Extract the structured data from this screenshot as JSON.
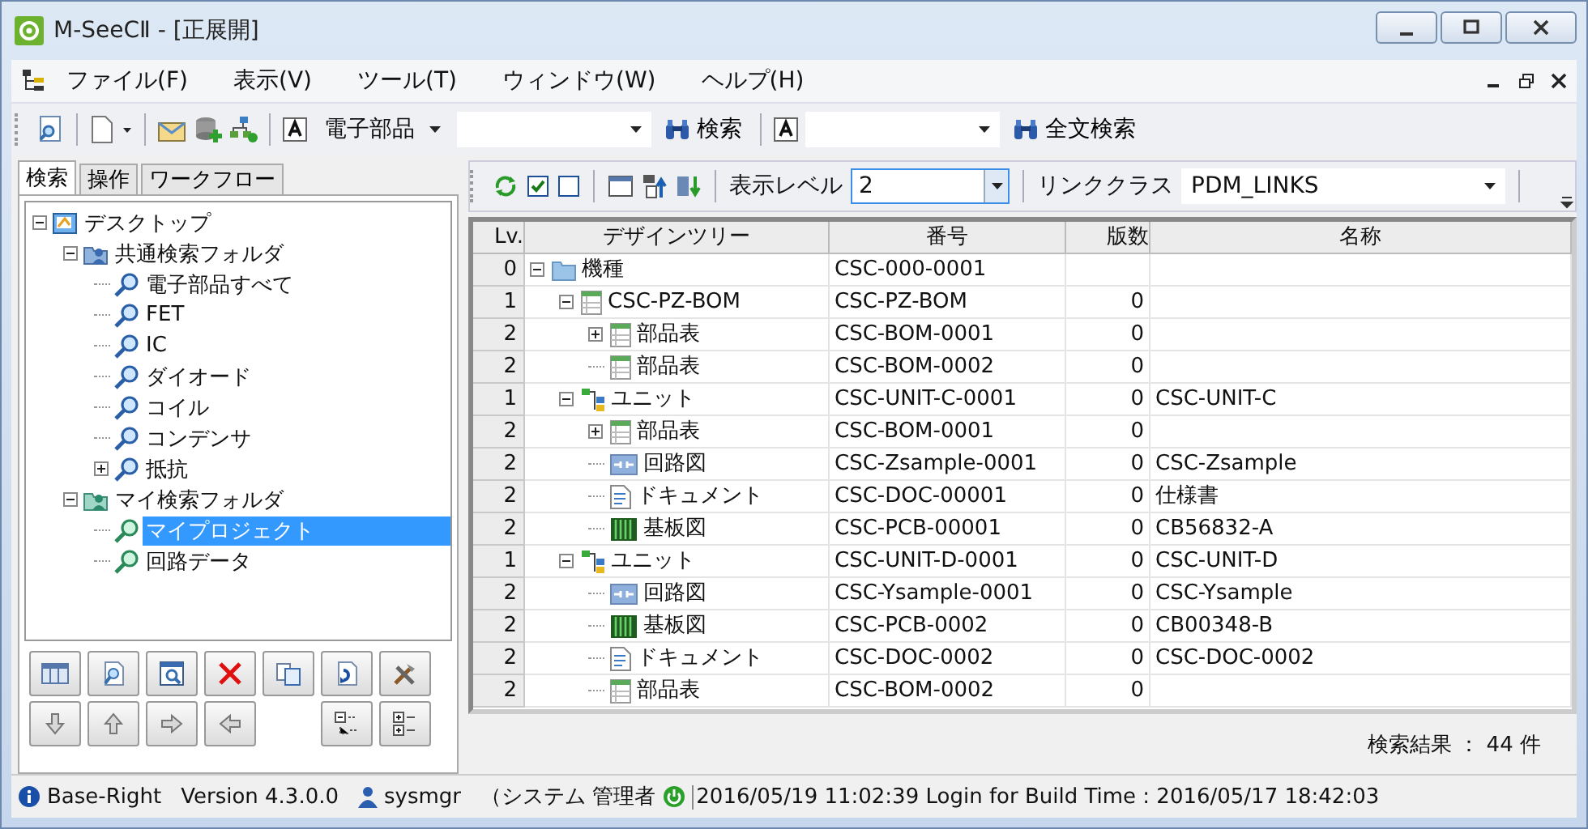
{
  "window": {
    "title": "M-SeeCⅡ - [正展開]"
  },
  "menu": [
    "ファイル(F)",
    "表示(V)",
    "ツール(T)",
    "ウィンドウ(W)",
    "ヘルプ(H)"
  ],
  "toolbar": {
    "category": "電子部品",
    "search_button": "検索",
    "fulltext_button": "全文検索"
  },
  "left_tabs": [
    {
      "label": "検索",
      "selected": true
    },
    {
      "label": "操作",
      "selected": false
    },
    {
      "label": "ワークフロー",
      "selected": false
    }
  ],
  "search_tree": [
    {
      "label": "デスクトップ",
      "kind": "desktop",
      "expanded": true,
      "selected": false,
      "children": [
        {
          "label": "共通検索フォルダ",
          "kind": "shared-folder",
          "expanded": true,
          "selected": false,
          "children": [
            {
              "label": "電子部品すべて",
              "kind": "search",
              "selected": false
            },
            {
              "label": "FET",
              "kind": "search",
              "selected": false
            },
            {
              "label": "IC",
              "kind": "search",
              "selected": false
            },
            {
              "label": "ダイオード",
              "kind": "search",
              "selected": false
            },
            {
              "label": "コイル",
              "kind": "search",
              "selected": false
            },
            {
              "label": "コンデンサ",
              "kind": "search",
              "selected": false
            },
            {
              "label": "抵抗",
              "kind": "search",
              "expanded": false,
              "selected": false
            }
          ]
        },
        {
          "label": "マイ検索フォルダ",
          "kind": "my-folder",
          "expanded": true,
          "selected": false,
          "children": [
            {
              "label": "マイプロジェクト",
              "kind": "my-search",
              "selected": true
            },
            {
              "label": "回路データ",
              "kind": "my-search",
              "selected": false
            }
          ]
        }
      ]
    }
  ],
  "design": {
    "level_label": "表示レベル",
    "level": "2",
    "link_label": "リンククラス",
    "link_class": "PDM_LINKS",
    "columns": [
      "Lv.",
      "デザインツリー",
      "番号",
      "版数",
      "名称"
    ],
    "rows": [
      {
        "lv": "0",
        "name": "機種",
        "kind": "folder",
        "number": "CSC-000-0001",
        "expanded": true,
        "children": [
          {
            "lv": "1",
            "name": "CSC-PZ-BOM",
            "kind": "bom",
            "number": "CSC-PZ-BOM",
            "version": "0",
            "expanded": true,
            "children": [
              {
                "lv": "2",
                "name": "部品表",
                "kind": "bom",
                "number": "CSC-BOM-0001",
                "version": "0",
                "expanded": false
              },
              {
                "lv": "2",
                "name": "部品表",
                "kind": "bom",
                "number": "CSC-BOM-0002",
                "version": "0"
              }
            ]
          },
          {
            "lv": "1",
            "name": "ユニット",
            "kind": "unit",
            "number": "CSC-UNIT-C-0001",
            "version": "0",
            "title": "CSC-UNIT-C",
            "expanded": true,
            "children": [
              {
                "lv": "2",
                "name": "部品表",
                "kind": "bom",
                "number": "CSC-BOM-0001",
                "version": "0",
                "expanded": false
              },
              {
                "lv": "2",
                "name": "回路図",
                "kind": "circuit",
                "number": "CSC-Zsample-0001",
                "version": "0",
                "title": "CSC-Zsample"
              },
              {
                "lv": "2",
                "name": "ドキュメント",
                "kind": "doc",
                "number": "CSC-DOC-00001",
                "version": "0",
                "title": "仕様書"
              },
              {
                "lv": "2",
                "name": "基板図",
                "kind": "pcb",
                "number": "CSC-PCB-00001",
                "version": "0",
                "title": "CB56832-A"
              }
            ]
          },
          {
            "lv": "1",
            "name": "ユニット",
            "kind": "unit",
            "number": "CSC-UNIT-D-0001",
            "version": "0",
            "title": "CSC-UNIT-D",
            "expanded": true,
            "children": [
              {
                "lv": "2",
                "name": "回路図",
                "kind": "circuit",
                "number": "CSC-Ysample-0001",
                "version": "0",
                "title": "CSC-Ysample"
              },
              {
                "lv": "2",
                "name": "基板図",
                "kind": "pcb",
                "number": "CSC-PCB-0002",
                "version": "0",
                "title": "CB00348-B"
              },
              {
                "lv": "2",
                "name": "ドキュメント",
                "kind": "doc",
                "number": "CSC-DOC-0002",
                "version": "0",
                "title": "CSC-DOC-0002"
              },
              {
                "lv": "2",
                "name": "部品表",
                "kind": "bom",
                "number": "CSC-BOM-0002",
                "version": "0"
              }
            ]
          }
        ]
      }
    ],
    "result": "検索結果 ： 44 件"
  },
  "status_bar": {
    "app": "Base-Right",
    "version": "Version 4.3.0.0",
    "user": "sysmgr",
    "role": "（システム 管理者",
    "login": "2016/05/19 11:02:39 Login for Build Time : 2016/05/17 18:42:03"
  }
}
